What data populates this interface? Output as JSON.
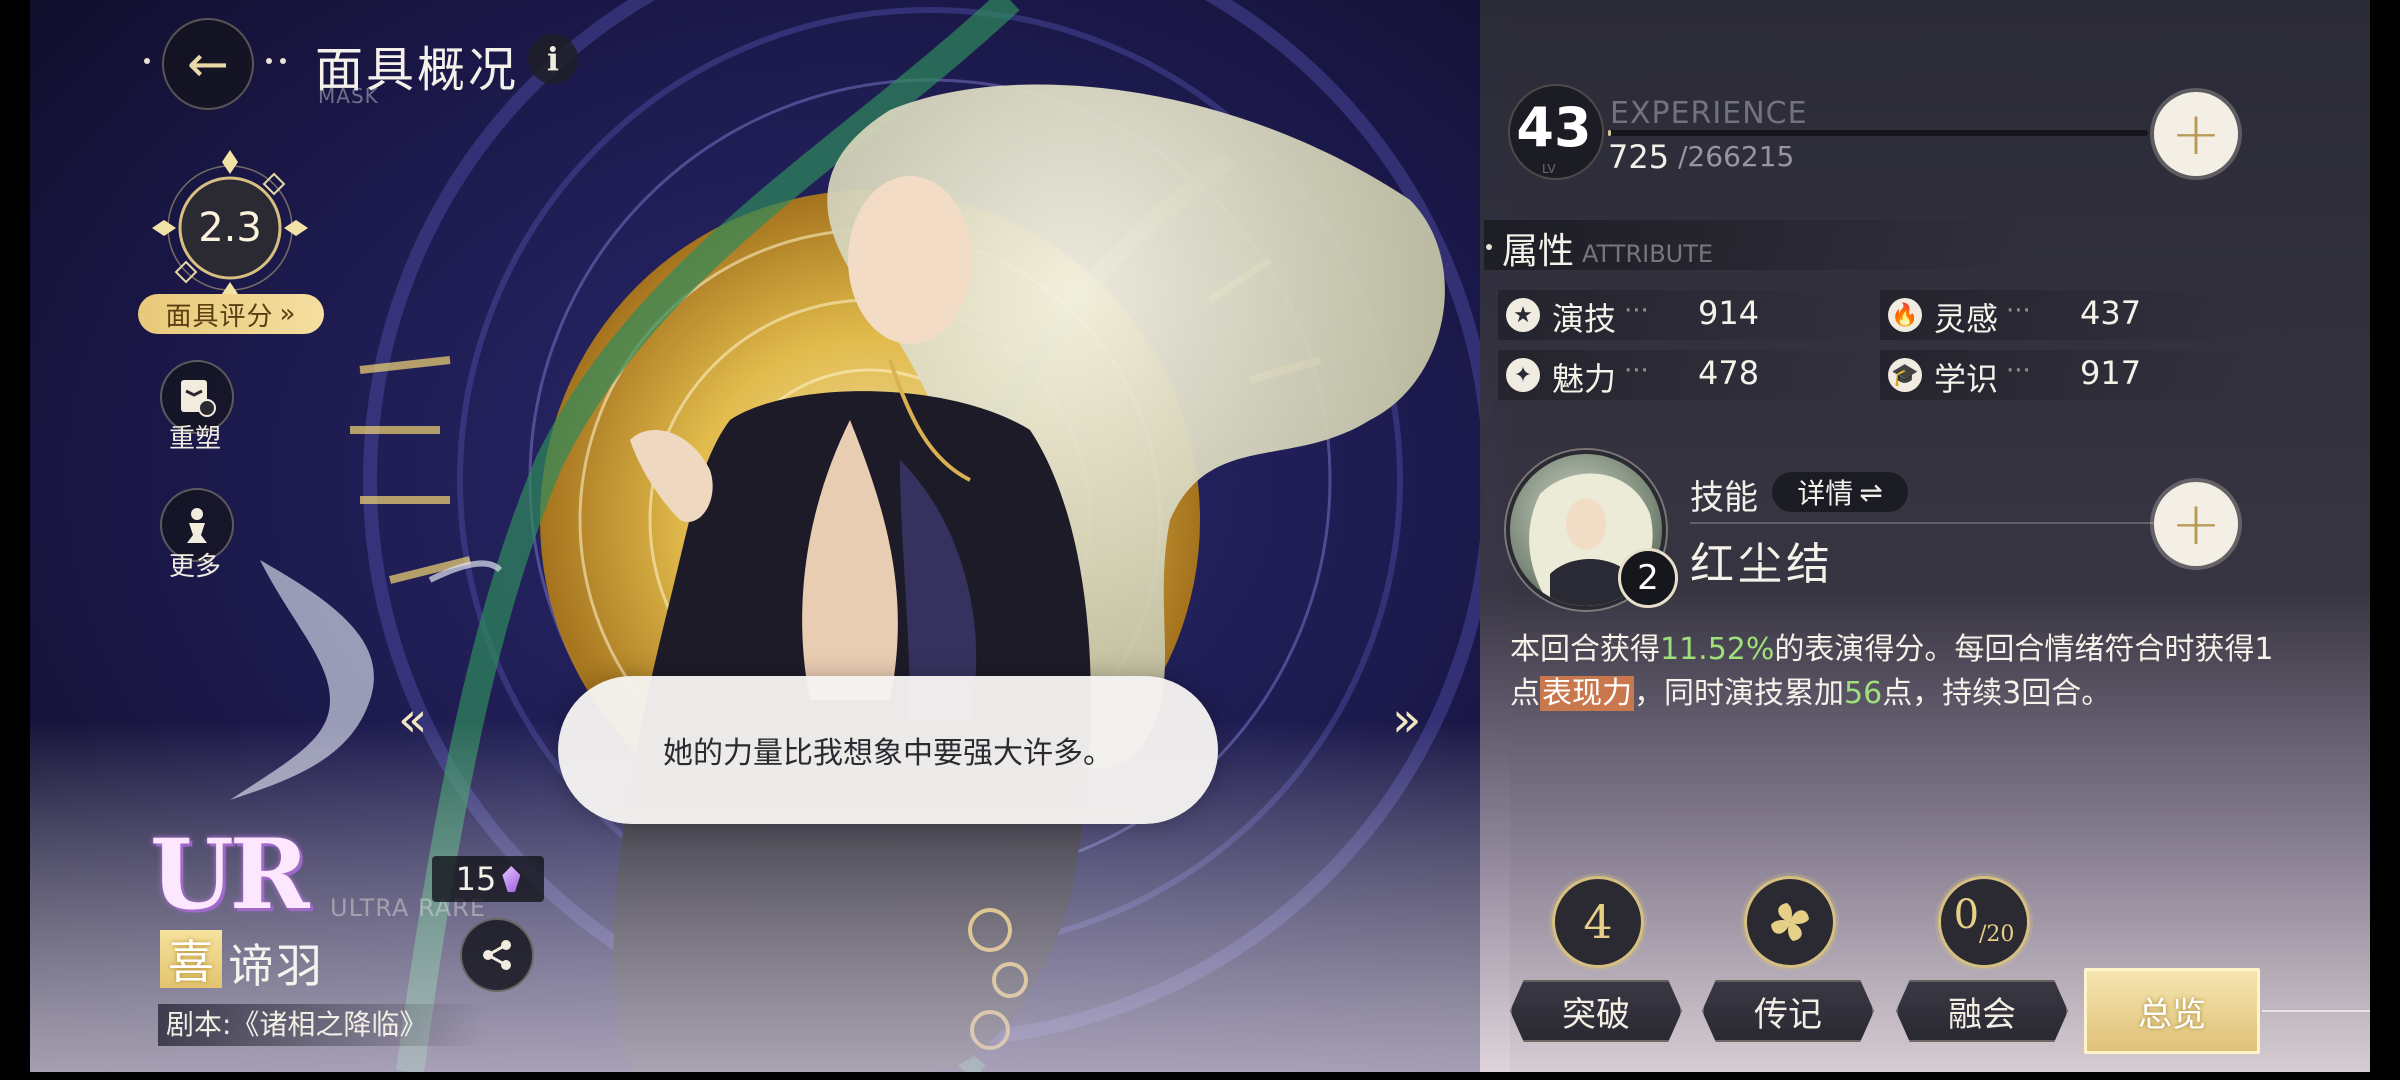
{
  "header": {
    "title": "面具概况",
    "subtitle": "MASK",
    "back_icon": "←",
    "info_icon": "i"
  },
  "rating": {
    "value": "2.3",
    "button_label": "面具评分",
    "button_icon": "»"
  },
  "side_actions": [
    {
      "label": "重塑"
    },
    {
      "label": "更多"
    }
  ],
  "navigation": {
    "prev": "«",
    "next": "»"
  },
  "dialogue": {
    "text": "她的力量比我想象中要强大许多。"
  },
  "character": {
    "rarity": "UR",
    "rarity_full": "ULTRA RARE",
    "count": "15",
    "emotion": "喜",
    "name": "谛羽",
    "script": "剧本:《诸相之降临》"
  },
  "level": {
    "value": "43",
    "label": "LV",
    "exp_title": "EXPERIENCE",
    "exp_current": "725",
    "exp_max": "/266215",
    "exp_progress": 0.0027,
    "plus_icon": "+"
  },
  "attributes": {
    "title": "属性",
    "title_en": "ATTRIBUTE",
    "dots": "···",
    "items": [
      {
        "name": "演技",
        "value": "914",
        "icon": "★"
      },
      {
        "name": "灵感",
        "value": "437",
        "icon": "🔥"
      },
      {
        "name": "魅力",
        "value": "478",
        "icon": "✦"
      },
      {
        "name": "学识",
        "value": "917",
        "icon": "🎓"
      }
    ]
  },
  "skill": {
    "label": "技能",
    "detail_label": "详情",
    "detail_icon": "⇌",
    "level": "2",
    "name": "红尘结",
    "plus_icon": "+",
    "desc": {
      "p1": "本回合获得",
      "h1": "11.52%",
      "p2": "的表演得分。每回合情绪符合时获得1点",
      "h2": "表现力",
      "p3": "，同时演技累加",
      "h3": "56",
      "p4": "点，持续3回合。"
    }
  },
  "bottom_tabs": [
    {
      "label": "突破",
      "icon_text": "4"
    },
    {
      "label": "传记",
      "icon_text": ""
    },
    {
      "label": "融会",
      "icon_text": "0",
      "icon_sub": "/20"
    },
    {
      "label": "总览",
      "active": true
    }
  ],
  "colors": {
    "accent_gold": "#e7c979",
    "highlight_green": "#9ee07a",
    "highlight_box": "#c9784d"
  }
}
